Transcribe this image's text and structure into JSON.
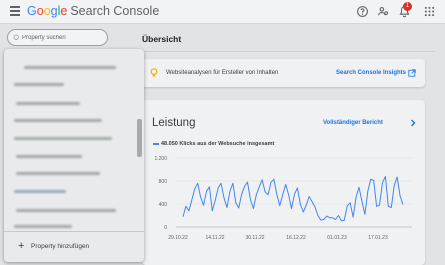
{
  "app": {
    "name_letters": [
      "G",
      "o",
      "o",
      "g",
      "l",
      "e"
    ],
    "product": "Search Console",
    "notification_count": "1"
  },
  "search": {
    "placeholder": "Property suchen",
    "value": ""
  },
  "page": {
    "title": "Übersicht"
  },
  "dropdown": {
    "add_property_label": "Property hinzufügen"
  },
  "insights": {
    "text": "Websiteanalysen für Ersteller von Inhalten",
    "link": "Search Console Insights"
  },
  "performance": {
    "title": "Leistung",
    "report_link": "Vollständiger Bericht",
    "legend": "48.050 Klicks aus der Websuche insgesamt"
  },
  "colors": {
    "accent": "#1a73e8",
    "series": "#4285f4",
    "badge": "#d93025"
  },
  "icons": [
    "menu-icon",
    "help-icon",
    "share-icon",
    "bell-icon",
    "apps-icon",
    "search-icon",
    "lightbulb-icon",
    "open-in-new-icon",
    "chevron-right-icon",
    "plus-icon"
  ],
  "chart_data": {
    "type": "line",
    "ylabel": "",
    "xlabel": "",
    "ylim": [
      0,
      1200
    ],
    "yticks": [
      "1.200",
      "800",
      "400",
      "0"
    ],
    "ytick_values": [
      1200,
      800,
      400,
      0
    ],
    "xticks": [
      "29.10.22",
      "14.11.22",
      "30.11.22",
      "16.12.22",
      "01.01.23",
      "17.01.23"
    ],
    "grid": true,
    "series": [
      {
        "values": [
          180,
          360,
          280,
          470,
          660,
          760,
          520,
          380,
          620,
          700,
          280,
          470,
          680,
          760,
          500,
          340,
          620,
          760,
          420,
          330,
          570,
          710,
          780,
          470,
          320,
          560,
          700,
          820,
          610,
          560,
          780,
          830,
          560,
          370,
          560,
          740,
          560,
          320,
          570,
          680,
          400,
          260,
          380,
          530,
          440,
          350,
          200,
          120,
          130,
          190,
          160,
          160,
          130,
          200,
          110,
          120,
          370,
          420,
          170,
          520,
          690,
          450,
          220,
          620,
          830,
          810,
          360,
          380,
          770,
          880,
          360,
          340,
          720,
          870,
          540,
          390
        ]
      }
    ]
  }
}
